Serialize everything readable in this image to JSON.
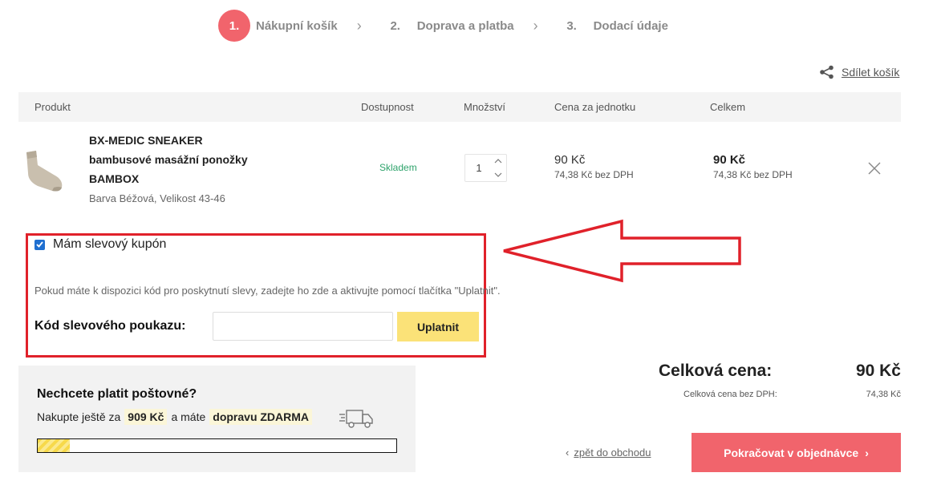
{
  "steps": [
    {
      "num": "1.",
      "label": "Nákupní košík"
    },
    {
      "num": "2.",
      "label": "Doprava a platba"
    },
    {
      "num": "3.",
      "label": "Dodací údaje"
    }
  ],
  "share": {
    "label": "Sdílet košík"
  },
  "table": {
    "headers": [
      "Produkt",
      "Dostupnost",
      "Množství",
      "Cena za jednotku",
      "Celkem"
    ]
  },
  "item": {
    "name": "BX-MEDIC SNEAKER bambusové masážní ponožky BAMBOX",
    "variant": "Barva Béžová, Velikost 43-46",
    "availability": "Skladem",
    "quantity": "1",
    "unit_price": "90 Kč",
    "unit_price_net": "74,38 Kč bez DPH",
    "total": "90 Kč",
    "total_net": "74,38 Kč bez DPH"
  },
  "coupon": {
    "checkbox_label": "Mám slevový kupón",
    "hint": "Pokud máte k dispozici kód pro poskytnutí slevy, zadejte ho zde a aktivujte pomocí tlačítka \"Uplatnit\".",
    "field_label": "Kód slevového poukazu:",
    "input_value": "",
    "apply_label": "Uplatnit"
  },
  "shipping": {
    "title": "Nechcete platit poštovné?",
    "text_before": "Nakupte ještě za",
    "amount": "909 Kč",
    "text_middle": "a máte",
    "free": "dopravu ZDARMA",
    "progress_fraction": 0.09
  },
  "totals": {
    "label": "Celková cena:",
    "value": "90 Kč",
    "net_label": "Celková cena bez DPH:",
    "net_value": "74,38 Kč"
  },
  "actions": {
    "back_label": "zpět do obchodu",
    "continue_label": "Pokračovat v objednávce"
  },
  "colors": {
    "accent": "#f1646c",
    "apply_button": "#fbe278",
    "highlight_border": "#e0212a",
    "in_stock": "#2ea36b"
  }
}
